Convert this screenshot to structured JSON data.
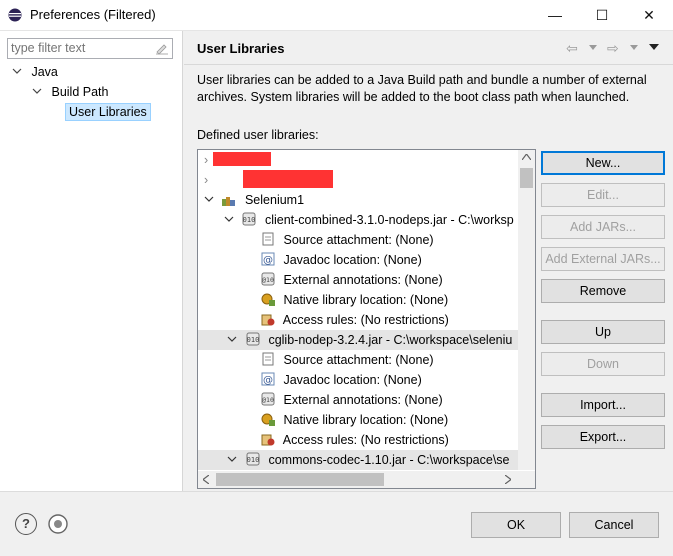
{
  "window": {
    "title": "Preferences (Filtered)",
    "minimize_glyph": "—",
    "maximize_glyph": "☐",
    "close_glyph": "✕"
  },
  "filter": {
    "placeholder": "type filter text",
    "value": ""
  },
  "nav_tree": {
    "java": "Java",
    "build_path": "Build Path",
    "user_libraries": "User Libraries"
  },
  "page": {
    "title": "User Libraries",
    "description": "User libraries can be added to a Java Build path and bundle a number of external archives. System libraries will be added to the boot class path when launched.",
    "defined_label": "Defined user libraries:"
  },
  "nav_arrows": {
    "back": "⇦",
    "forward": "⇨"
  },
  "libraries": {
    "selenium": {
      "name": "Selenium1",
      "jars": [
        {
          "label": "client-combined-3.1.0-nodeps.jar - C:\\worksp",
          "attrs": [
            {
              "icon": "source-attachment-icon",
              "text": "Source attachment: (None)"
            },
            {
              "icon": "javadoc-icon",
              "text": "Javadoc location: (None)"
            },
            {
              "icon": "external-annotations-icon",
              "text": "External annotations: (None)"
            },
            {
              "icon": "native-library-icon",
              "text": "Native library location: (None)"
            },
            {
              "icon": "access-rules-icon",
              "text": "Access rules: (No restrictions)"
            }
          ]
        },
        {
          "label": "cglib-nodep-3.2.4.jar - C:\\workspace\\seleniu",
          "attrs": [
            {
              "icon": "source-attachment-icon",
              "text": "Source attachment: (None)"
            },
            {
              "icon": "javadoc-icon",
              "text": "Javadoc location: (None)"
            },
            {
              "icon": "external-annotations-icon",
              "text": "External annotations: (None)"
            },
            {
              "icon": "native-library-icon",
              "text": "Native library location: (None)"
            },
            {
              "icon": "access-rules-icon",
              "text": "Access rules: (No restrictions)"
            }
          ]
        },
        {
          "label": "commons-codec-1.10.jar - C:\\workspace\\se"
        }
      ]
    }
  },
  "side_buttons": {
    "new": "New...",
    "edit": "Edit...",
    "add_jars": "Add JARs...",
    "add_external_jars": "Add External JARs...",
    "remove": "Remove",
    "up": "Up",
    "down": "Down",
    "import": "Import...",
    "export": "Export..."
  },
  "footer": {
    "ok": "OK",
    "cancel": "Cancel",
    "help_glyph": "?"
  },
  "colors": {
    "selection": "#cce8ff",
    "default_border": "#0078d7",
    "redaction": "#ff3333"
  }
}
